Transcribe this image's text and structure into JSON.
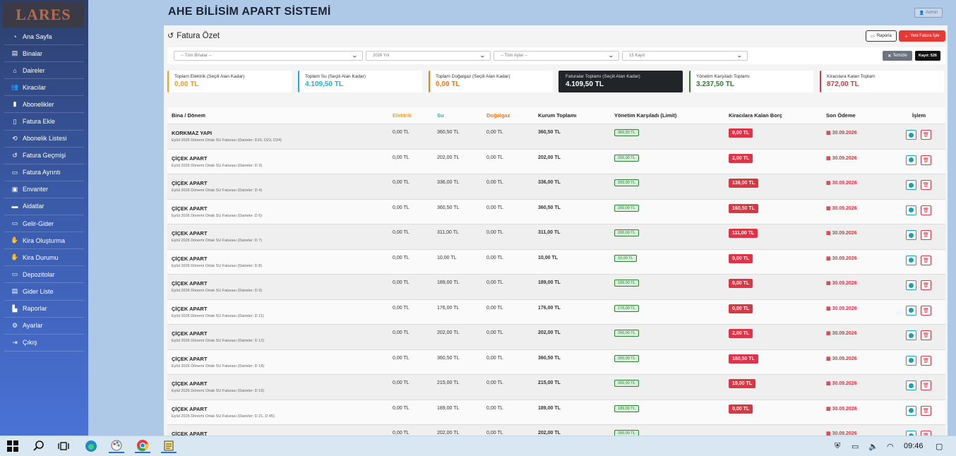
{
  "sidebar": {
    "logo": "LARES",
    "items": [
      {
        "label": "Ana Sayfa",
        "icon": "gauge-icon",
        "glyph": "◔"
      },
      {
        "label": "Binalar",
        "icon": "building-icon",
        "glyph": "▤"
      },
      {
        "label": "Daireler",
        "icon": "home-icon",
        "glyph": "⌂"
      },
      {
        "label": "Kiracılar",
        "icon": "users-icon",
        "glyph": "👥"
      },
      {
        "label": "Abonelikler",
        "icon": "plug-icon",
        "glyph": "▮"
      },
      {
        "label": "Fatura Ekle",
        "icon": "file-plus-icon",
        "glyph": "▯"
      },
      {
        "label": "Abonelik Listesi",
        "icon": "sync-icon",
        "glyph": "⟲"
      },
      {
        "label": "Fatura Geçmişi",
        "icon": "history-icon",
        "glyph": "↺"
      },
      {
        "label": "Fatura Ayrıntı",
        "icon": "money-icon",
        "glyph": "▭"
      },
      {
        "label": "Envanter",
        "icon": "box-icon",
        "glyph": "▣"
      },
      {
        "label": "Aidatlar",
        "icon": "wallet-icon",
        "glyph": "▬"
      },
      {
        "label": "Gelir-Gider",
        "icon": "cash-icon",
        "glyph": "▭"
      },
      {
        "label": "Kira Oluşturma",
        "icon": "hand-money-icon",
        "glyph": "✋"
      },
      {
        "label": "Kira Durumu",
        "icon": "hand-holding-icon",
        "glyph": "✋"
      },
      {
        "label": "Depozitolar",
        "icon": "deposit-icon",
        "glyph": "▭"
      },
      {
        "label": "Gider Liste",
        "icon": "list-icon",
        "glyph": "▤"
      },
      {
        "label": "Raporlar",
        "icon": "chart-icon",
        "glyph": "▙"
      },
      {
        "label": "Ayarlar",
        "icon": "gear-icon",
        "glyph": "⚙"
      },
      {
        "label": "Çıkış",
        "icon": "logout-icon",
        "glyph": "⇥"
      }
    ]
  },
  "header": {
    "title": "AHE BİLİSİM APART SİSTEMİ",
    "user": "Admin"
  },
  "page": {
    "title": "Fatura Özet",
    "report_label": "Raporla",
    "new_label": "Yeni Fatura İşle"
  },
  "filters": {
    "building": "-- Tüm Binalar --",
    "year": "2026 Yılı",
    "month": "-- Tüm Aylar --",
    "page_size": "15 Kayıt",
    "clear_label": "Temizle",
    "record_count": "Kayıt: 526"
  },
  "summary": [
    {
      "label": "Toplam Elektrik (Seçili Alan Kadar)",
      "value": "0,00 TL",
      "color": "#f0a020"
    },
    {
      "label": "Toplam Su (Seçili Alan Kadar)",
      "value": "4.109,50 TL",
      "color": "#17b3d6"
    },
    {
      "label": "Toplam Doğalgaz (Seçili Alan Kadar)",
      "value": "0,00 TL",
      "color": "#f07a1a"
    },
    {
      "label": "Faturalar Toplamı (Seçili Alan Kadar)",
      "value": "4.109,50 TL",
      "color": "#ffffff"
    },
    {
      "label": "Yönetim Karşıladı Toplamı",
      "value": "3.237,50 TL",
      "color": "#2e7d32"
    },
    {
      "label": "Kiracılara Kalan Toplam",
      "value": "872,00 TL",
      "color": "#dc3545"
    }
  ],
  "table": {
    "headers": {
      "name": "Bina / Dönem",
      "elec": "Elektrik",
      "water": "Su",
      "gas": "Doğalgaz",
      "total": "Kurum Toplamı",
      "limit": "Yönetim Karşıladı (Limit)",
      "debt": "Kiracılara Kalan Borç",
      "last": "Son Ödeme",
      "action": "İşlem"
    },
    "rows": [
      {
        "name": "KORKMAZ YAPI",
        "desc": "Eylül 2026 Dönemi Ortak SU Faturası (Daireler: D16, D23, D24)",
        "elec": "0,00 TL",
        "water": "360,50 TL",
        "gas": "0,00 TL",
        "total": "360,50 TL",
        "limit": "360,50 TL",
        "debt": "0,00 TL",
        "date": "30.09.2026"
      },
      {
        "name": "ÇİÇEK APART",
        "desc": "Eylül 2026 Dönemi Ortak SU Faturası (Daireler: D 3)",
        "elec": "0,00 TL",
        "water": "202,00 TL",
        "gas": "0,00 TL",
        "total": "202,00 TL",
        "limit": "200,00 TL",
        "debt": "2,00 TL",
        "date": "30.09.2026"
      },
      {
        "name": "ÇİÇEK APART",
        "desc": "Eylül 2026 Dönemi Ortak SU Faturası (Daireler: D 4)",
        "elec": "0,00 TL",
        "water": "336,00 TL",
        "gas": "0,00 TL",
        "total": "336,00 TL",
        "limit": "200,00 TL",
        "debt": "136,00 TL",
        "date": "30.09.2026"
      },
      {
        "name": "ÇİÇEK APART",
        "desc": "Eylül 2026 Dönemi Ortak SU Faturası (Daireler: D 6)",
        "elec": "0,00 TL",
        "water": "360,50 TL",
        "gas": "0,00 TL",
        "total": "360,50 TL",
        "limit": "200,00 TL",
        "debt": "160,50 TL",
        "date": "30.09.2026"
      },
      {
        "name": "ÇİÇEK APART",
        "desc": "Eylül 2026 Dönemi Ortak SU Faturası (Daireler: D 7)",
        "elec": "0,00 TL",
        "water": "311,00 TL",
        "gas": "0,00 TL",
        "total": "311,00 TL",
        "limit": "200,00 TL",
        "debt": "111,00 TL",
        "date": "30.09.2026"
      },
      {
        "name": "ÇİÇEK APART",
        "desc": "Eylül 2026 Dönemi Ortak SU Faturası (Daireler: D 8)",
        "elec": "0,00 TL",
        "water": "10,00 TL",
        "gas": "0,00 TL",
        "total": "10,00 TL",
        "limit": "10,00 TL",
        "debt": "0,00 TL",
        "date": "30.09.2026"
      },
      {
        "name": "ÇİÇEK APART",
        "desc": "Eylül 2026 Dönemi Ortak SU Faturası (Daireler: D 9)",
        "elec": "0,00 TL",
        "water": "189,00 TL",
        "gas": "0,00 TL",
        "total": "189,00 TL",
        "limit": "189,00 TL",
        "debt": "0,00 TL",
        "date": "30.09.2026"
      },
      {
        "name": "ÇİÇEK APART",
        "desc": "Eylül 2026 Dönemi Ortak SU Faturası (Daireler: D 11)",
        "elec": "0,00 TL",
        "water": "176,00 TL",
        "gas": "0,00 TL",
        "total": "176,00 TL",
        "limit": "176,00 TL",
        "debt": "0,00 TL",
        "date": "30.09.2026"
      },
      {
        "name": "ÇİÇEK APART",
        "desc": "Eylül 2026 Dönemi Ortak SU Faturası (Daireler: D 12)",
        "elec": "0,00 TL",
        "water": "202,00 TL",
        "gas": "0,00 TL",
        "total": "202,00 TL",
        "limit": "200,00 TL",
        "debt": "2,00 TL",
        "date": "30.09.2026"
      },
      {
        "name": "ÇİÇEK APART",
        "desc": "Eylül 2026 Dönemi Ortak SU Faturası (Daireler: D 18)",
        "elec": "0,00 TL",
        "water": "360,50 TL",
        "gas": "0,00 TL",
        "total": "360,50 TL",
        "limit": "200,00 TL",
        "debt": "160,50 TL",
        "date": "30.09.2026"
      },
      {
        "name": "ÇİÇEK APART",
        "desc": "Eylül 2026 Dönemi Ortak SU Faturası (Daireler: D 19)",
        "elec": "0,00 TL",
        "water": "215,00 TL",
        "gas": "0,00 TL",
        "total": "215,00 TL",
        "limit": "200,00 TL",
        "debt": "15,00 TL",
        "date": "30.09.2026"
      },
      {
        "name": "ÇİÇEK APART",
        "desc": "Eylül 2026 Dönemi Ortak SU Faturası (Daireler: D 21, D 45)",
        "elec": "0,00 TL",
        "water": "189,00 TL",
        "gas": "0,00 TL",
        "total": "189,00 TL",
        "limit": "189,00 TL",
        "debt": "0,00 TL",
        "date": "30.09.2026"
      },
      {
        "name": "ÇİÇEK APART",
        "desc": "",
        "elec": "0,00 TL",
        "water": "202,00 TL",
        "gas": "0,00 TL",
        "total": "202,00 TL",
        "limit": "200,00 TL",
        "debt": "",
        "date": "30.09.2026"
      }
    ]
  },
  "taskbar": {
    "apps": [
      "windows-start-icon",
      "search-icon",
      "task-view-icon",
      "edge-icon",
      "paint-icon",
      "chrome-icon",
      "notepad-icon"
    ],
    "time": "09:46"
  }
}
